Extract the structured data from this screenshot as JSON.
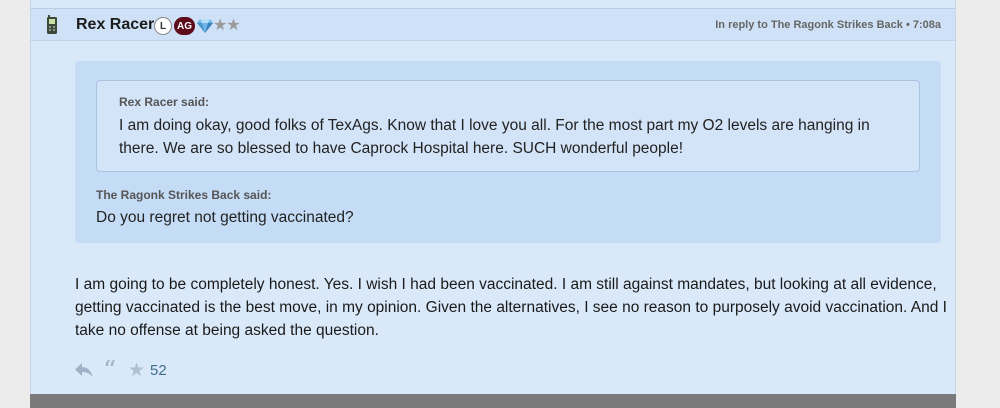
{
  "post": {
    "author": "Rex Racer",
    "badges": {
      "level": "L",
      "school": "AG"
    },
    "icons": [
      "phone-icon",
      "gem-icon"
    ],
    "rank_stars": "★★",
    "reply_meta": "In reply to The Ragonk Strikes Back • 7:08a",
    "quote": {
      "outer_author_label": "The Ragonk Strikes Back said:",
      "outer_text": "Do you regret not getting vaccinated?",
      "inner_author_label": "Rex Racer said:",
      "inner_text": "I am doing okay, good folks of TexAgs. Know that I love you all. For the most part my O2 levels are hanging in there. We are so blessed to have Caprock Hospital here. SUCH wonderful people!"
    },
    "body": "I am going to be completely honest. Yes. I wish I had been vaccinated. I am still against mandates, but looking at all evidence, getting vaccinated is the best move, in my opinion. Given the alternatives, I see no reason to purposely avoid vaccination. And I take no offense at being asked the question.",
    "actions": {
      "quote_glyph": "“",
      "star_glyph": "★",
      "star_count": "52"
    }
  },
  "colors": {
    "post_bg": "#dae9fa",
    "header_bg": "#cfe1f6",
    "quote_outer_bg": "#c5dcf6",
    "quote_inner_bg": "#d3e4f8",
    "ag_badge": "#5d0a1a",
    "count_color": "#3f6d8a"
  }
}
